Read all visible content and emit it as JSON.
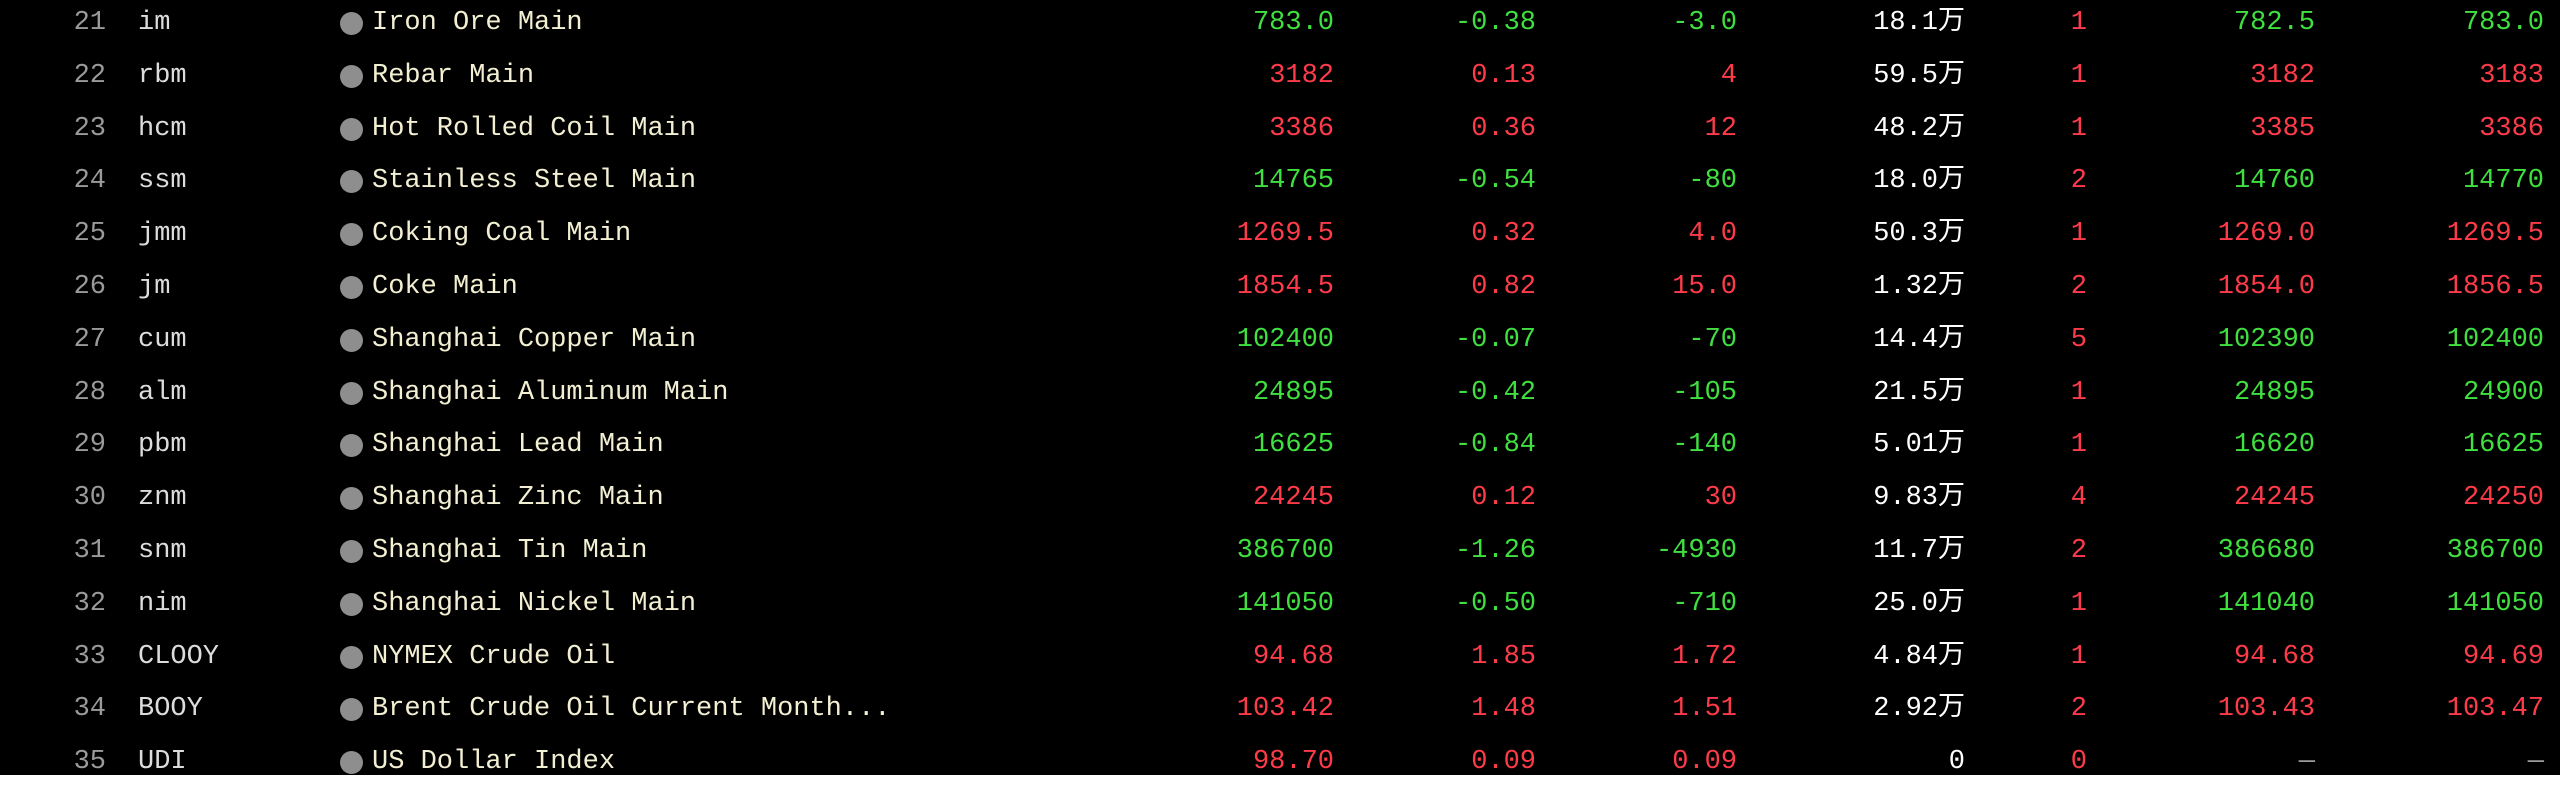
{
  "rows": [
    {
      "idx": "21",
      "code": "im",
      "name": "Iron Ore Main",
      "last": "783.0",
      "pct": "-0.38",
      "chg": "-3.0",
      "vol": "18.1万",
      "count": "1",
      "bid": "782.5",
      "ask": "783.0",
      "dir": "down"
    },
    {
      "idx": "22",
      "code": "rbm",
      "name": "Rebar Main",
      "last": "3182",
      "pct": "0.13",
      "chg": "4",
      "vol": "59.5万",
      "count": "1",
      "bid": "3182",
      "ask": "3183",
      "dir": "up"
    },
    {
      "idx": "23",
      "code": "hcm",
      "name": "Hot Rolled Coil Main",
      "last": "3386",
      "pct": "0.36",
      "chg": "12",
      "vol": "48.2万",
      "count": "1",
      "bid": "3385",
      "ask": "3386",
      "dir": "up"
    },
    {
      "idx": "24",
      "code": "ssm",
      "name": "Stainless Steel Main",
      "last": "14765",
      "pct": "-0.54",
      "chg": "-80",
      "vol": "18.0万",
      "count": "2",
      "bid": "14760",
      "ask": "14770",
      "dir": "down"
    },
    {
      "idx": "25",
      "code": "jmm",
      "name": "Coking Coal Main",
      "last": "1269.5",
      "pct": "0.32",
      "chg": "4.0",
      "vol": "50.3万",
      "count": "1",
      "bid": "1269.0",
      "ask": "1269.5",
      "dir": "up"
    },
    {
      "idx": "26",
      "code": "jm",
      "name": "Coke Main",
      "last": "1854.5",
      "pct": "0.82",
      "chg": "15.0",
      "vol": "1.32万",
      "count": "2",
      "bid": "1854.0",
      "ask": "1856.5",
      "dir": "up"
    },
    {
      "idx": "27",
      "code": "cum",
      "name": "Shanghai Copper Main",
      "last": "102400",
      "pct": "-0.07",
      "chg": "-70",
      "vol": "14.4万",
      "count": "5",
      "bid": "102390",
      "ask": "102400",
      "dir": "down"
    },
    {
      "idx": "28",
      "code": "alm",
      "name": "Shanghai Aluminum Main",
      "last": "24895",
      "pct": "-0.42",
      "chg": "-105",
      "vol": "21.5万",
      "count": "1",
      "bid": "24895",
      "ask": "24900",
      "dir": "down"
    },
    {
      "idx": "29",
      "code": "pbm",
      "name": "Shanghai Lead Main",
      "last": "16625",
      "pct": "-0.84",
      "chg": "-140",
      "vol": "5.01万",
      "count": "1",
      "bid": "16620",
      "ask": "16625",
      "dir": "down"
    },
    {
      "idx": "30",
      "code": "znm",
      "name": "Shanghai Zinc Main",
      "last": "24245",
      "pct": "0.12",
      "chg": "30",
      "vol": "9.83万",
      "count": "4",
      "bid": "24245",
      "ask": "24250",
      "dir": "up"
    },
    {
      "idx": "31",
      "code": "snm",
      "name": "Shanghai Tin Main",
      "last": "386700",
      "pct": "-1.26",
      "chg": "-4930",
      "vol": "11.7万",
      "count": "2",
      "bid": "386680",
      "ask": "386700",
      "dir": "down"
    },
    {
      "idx": "32",
      "code": "nim",
      "name": "Shanghai Nickel Main",
      "last": "141050",
      "pct": "-0.50",
      "chg": "-710",
      "vol": "25.0万",
      "count": "1",
      "bid": "141040",
      "ask": "141050",
      "dir": "down"
    },
    {
      "idx": "33",
      "code": "CLOOY",
      "name": "NYMEX Crude Oil",
      "last": "94.68",
      "pct": "1.85",
      "chg": "1.72",
      "vol": "4.84万",
      "count": "1",
      "bid": "94.68",
      "ask": "94.69",
      "dir": "up"
    },
    {
      "idx": "34",
      "code": "BOOY",
      "name": "Brent Crude Oil Current Month...",
      "last": "103.42",
      "pct": "1.48",
      "chg": "1.51",
      "vol": "2.92万",
      "count": "2",
      "bid": "103.43",
      "ask": "103.47",
      "dir": "up"
    },
    {
      "idx": "35",
      "code": "UDI",
      "name": "US Dollar Index",
      "last": "98.70",
      "pct": "0.09",
      "chg": "0.09",
      "vol": "0",
      "count": "0",
      "bid": "—",
      "ask": "—",
      "dir": "up"
    }
  ],
  "colors": {
    "up": "#ff3b4a",
    "down": "#3fe03f",
    "background": "#000000",
    "name": "#f3efd2",
    "code": "#dcdcdc",
    "index": "#9a9a9a"
  }
}
